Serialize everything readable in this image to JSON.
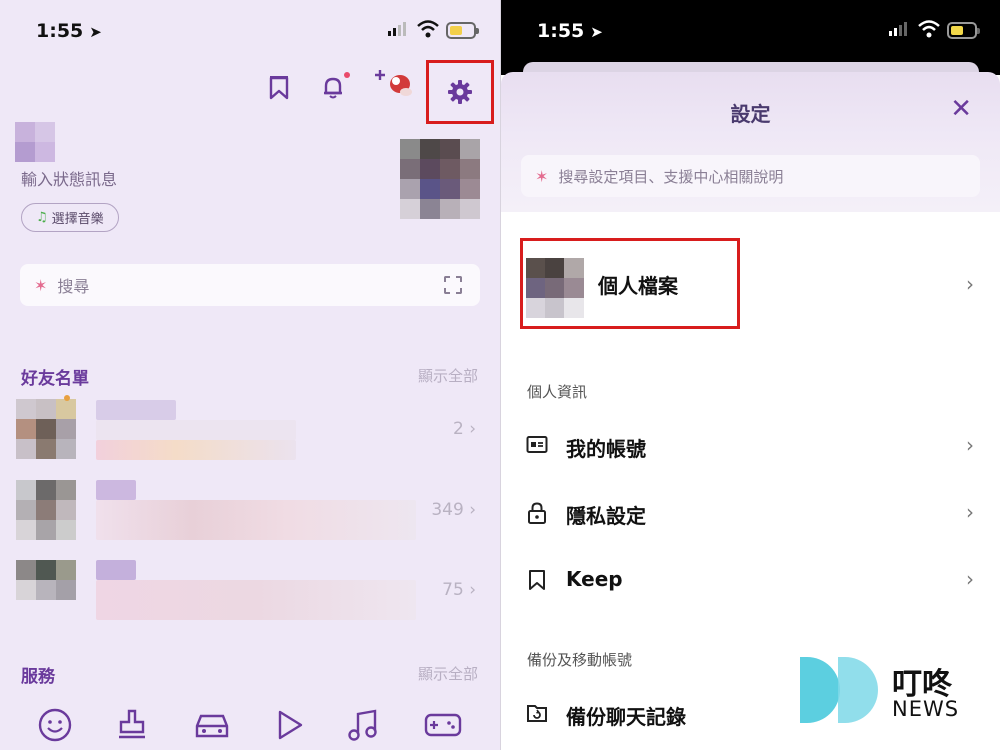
{
  "left": {
    "status_time": "1:55",
    "status_message": "輸入狀態訊息",
    "music_button": "選擇音樂",
    "search_placeholder": "搜尋",
    "friends_title": "好友名單",
    "friends_show_all": "顯示全部",
    "friends": [
      {
        "count": "2"
      },
      {
        "count": "349"
      },
      {
        "count": "75"
      }
    ],
    "services_title": "服務",
    "services_show_all": "顯示全部",
    "nav_icons": [
      "emoji-icon",
      "stamp-icon",
      "car-icon",
      "play-icon",
      "music-icon",
      "game-icon"
    ]
  },
  "right": {
    "status_time": "1:55",
    "title": "設定",
    "search_placeholder": "搜尋設定項目、支援中心相關說明",
    "profile_label": "個人檔案",
    "group_personal": "個人資訊",
    "menu": [
      {
        "icon": "id-card-icon",
        "label": "我的帳號"
      },
      {
        "icon": "lock-icon",
        "label": "隱私設定"
      },
      {
        "icon": "bookmark-icon",
        "label": "Keep"
      }
    ],
    "group_backup": "備份及移動帳號",
    "backup_label": "備份聊天記錄"
  },
  "logo": {
    "title": "叮咚",
    "subtitle": "NEWS",
    "colors": [
      "#5ac8dc",
      "#3ab0cc"
    ]
  },
  "colors": {
    "accent": "#6a3a9c",
    "highlight_box": "#d81d1d"
  }
}
